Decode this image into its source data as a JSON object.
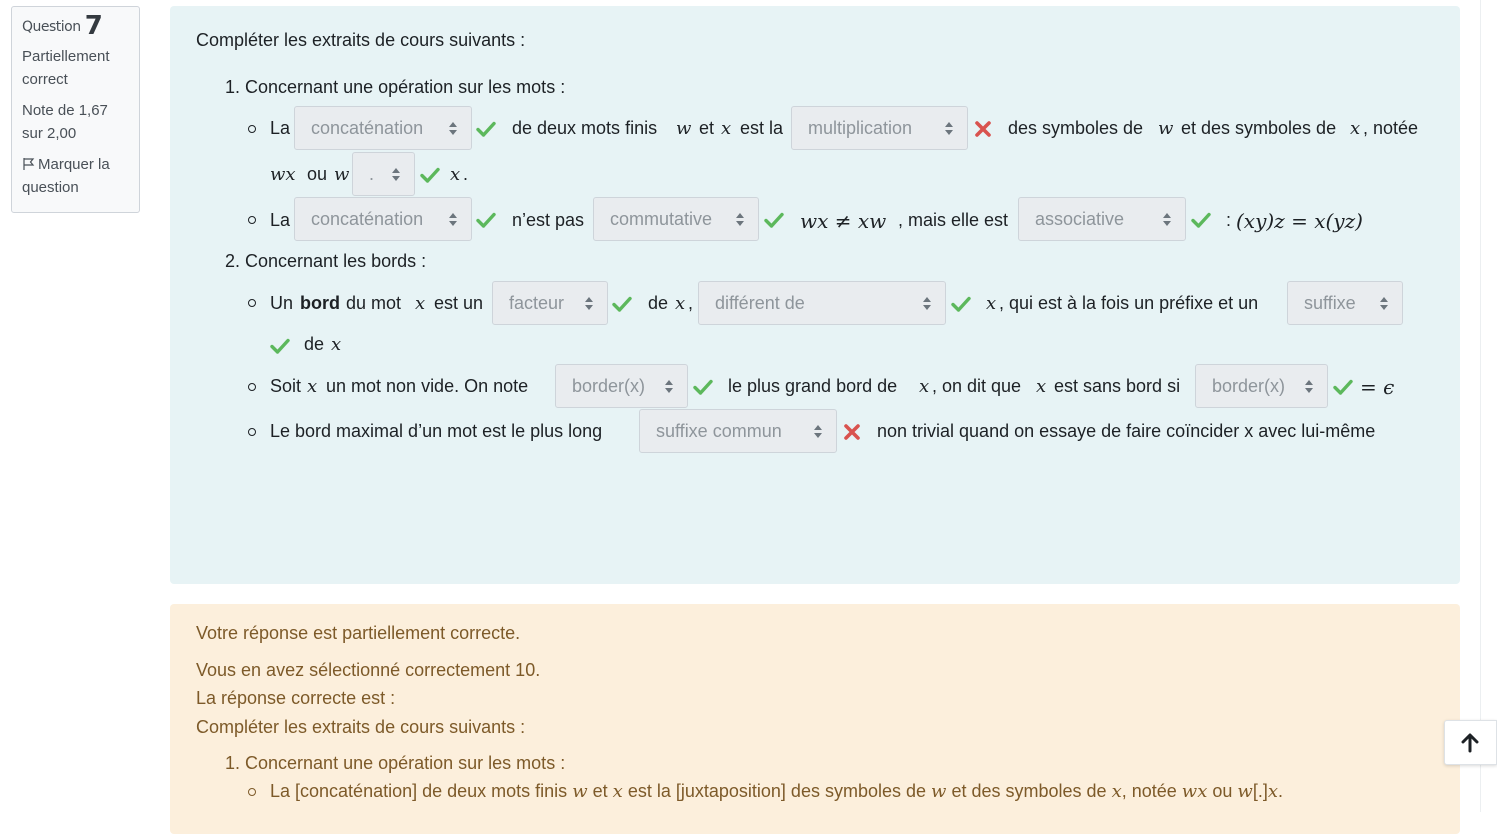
{
  "question": {
    "label": "Question",
    "number": "7",
    "state": "Partiellement correct",
    "grade": "Note de 1,67 sur 2,00",
    "flag_label": "Marquer la question"
  },
  "intro": "Compléter les extraits de cours suivants :",
  "section1": {
    "title": "1. Concernant une opération sur les mots :",
    "b1": {
      "t_la": "La",
      "sel1": "concaténation",
      "t_after1": "de deux mots finis",
      "t_et": "et",
      "t_estla": "est la",
      "sel2": "multiplication",
      "t_after2": "des symboles de",
      "t_etdes": "et des symboles de",
      "t_notee": ", notée",
      "t_ou": "ou",
      "sel3": ".",
      "t_end": "."
    },
    "b2": {
      "t_la": "La",
      "sel1": "concaténation",
      "t_nest": "n’est pas",
      "sel2": "commutative",
      "t_mais": ", mais elle est",
      "sel3": "associative",
      "t_colon": ":"
    }
  },
  "section2": {
    "title": "2. Concernant les bords :",
    "b1": {
      "t_un": "Un",
      "t_bord": "bord",
      "t_dumot": "du mot",
      "t_estun": "est un",
      "sel1": "facteur",
      "t_de": "de",
      "sel2": "différent de",
      "t_qui": ", qui est à la fois un préfixe et un",
      "sel3": "suffixe",
      "t_de2": "de"
    },
    "b2": {
      "t_soit": "Soit",
      "t_nonvide": "un mot non vide. On note",
      "sel1": "border(x)",
      "t_plus": "le plus grand bord de",
      "t_ondit": ", on dit que",
      "t_sans": "est sans bord si",
      "sel2": "border(x)"
    },
    "b3": {
      "t_le": "Le bord maximal d’un mot est le plus long",
      "sel1": "suffixe commun",
      "t_rest": "non trivial quand on essaye de faire coïncider x avec lui-même"
    }
  },
  "feedback": {
    "status": "Votre réponse est partiellement correcte.",
    "count": "Vous en avez sélectionné correctement 10.",
    "correct_label": "La réponse correcte est :",
    "intro": "Compléter les extraits de cours suivants :",
    "s1_title": "1. Concernant une opération sur les mots :",
    "l1_a": "La [concaténation] de deux mots finis",
    "l1_b": "et",
    "l1_c": "est la [juxtaposition] des symboles de",
    "l1_d": "et des symboles de",
    "l1_e": ", notée",
    "l1_f": "ou",
    "l1_g": "[.]",
    "l1_h": "."
  },
  "math": {
    "w": "w",
    "x": "x",
    "wx": "wx",
    "neq": "wx ≠ xw",
    "assoc": "(xy)z = x(yz)",
    "eps": "= ϵ"
  },
  "colors": {
    "question_bg": "#e7f3f5",
    "feedback_bg": "#fcefdc",
    "correct": "#5cb85c",
    "incorrect": "#d9534f"
  },
  "icons": {
    "correct": "check-icon",
    "incorrect": "cross-icon",
    "flag": "flag-icon",
    "top": "arrow-up-icon"
  }
}
